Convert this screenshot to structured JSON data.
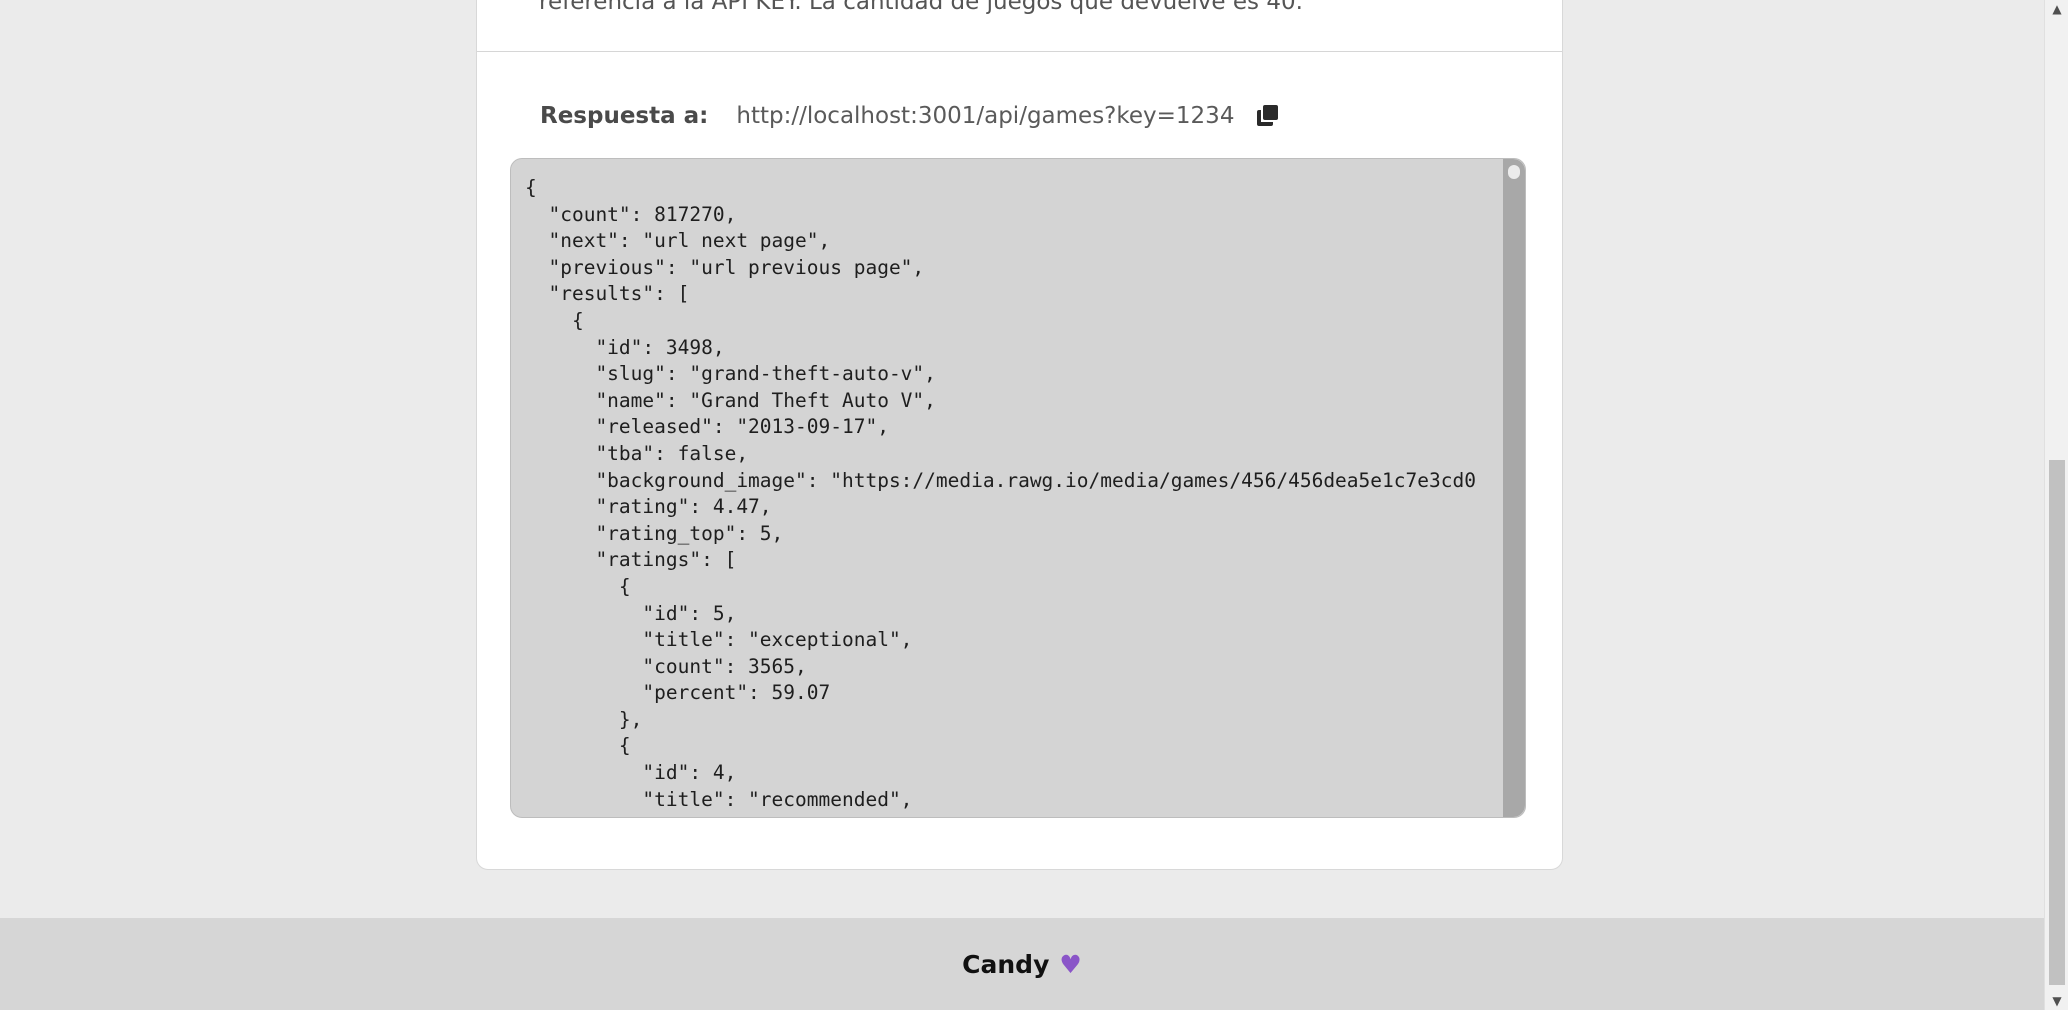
{
  "description": {
    "text": "referencia a la API KEY. La cantidad de juegos que devuelve es 40."
  },
  "response": {
    "label": "Respuesta a:",
    "url": "http://localhost:3001/api/games?key=1234",
    "copy_icon": "copy-icon"
  },
  "code": {
    "lines": [
      "{",
      "  \"count\": 817270,",
      "  \"next\": \"url next page\",",
      "  \"previous\": \"url previous page\",",
      "  \"results\": [",
      "    {",
      "      \"id\": 3498,",
      "      \"slug\": \"grand-theft-auto-v\",",
      "      \"name\": \"Grand Theft Auto V\",",
      "      \"released\": \"2013-09-17\",",
      "      \"tba\": false,",
      "      \"background_image\": \"https://media.rawg.io/media/games/456/456dea5e1c7e3cd0",
      "      \"rating\": 4.47,",
      "      \"rating_top\": 5,",
      "      \"ratings\": [",
      "        {",
      "          \"id\": 5,",
      "          \"title\": \"exceptional\",",
      "          \"count\": 3565,",
      "          \"percent\": 59.07",
      "        },",
      "        {",
      "          \"id\": 4,",
      "          \"title\": \"recommended\","
    ]
  },
  "footer": {
    "text": "Candy",
    "icon": "purple-heart-icon",
    "heart_color": "#8a55c8"
  },
  "colors": {
    "page_bg": "#ebebeb",
    "card_bg": "#ffffff",
    "code_bg": "#d4d4d4",
    "footer_bg": "#d6d6d6"
  }
}
